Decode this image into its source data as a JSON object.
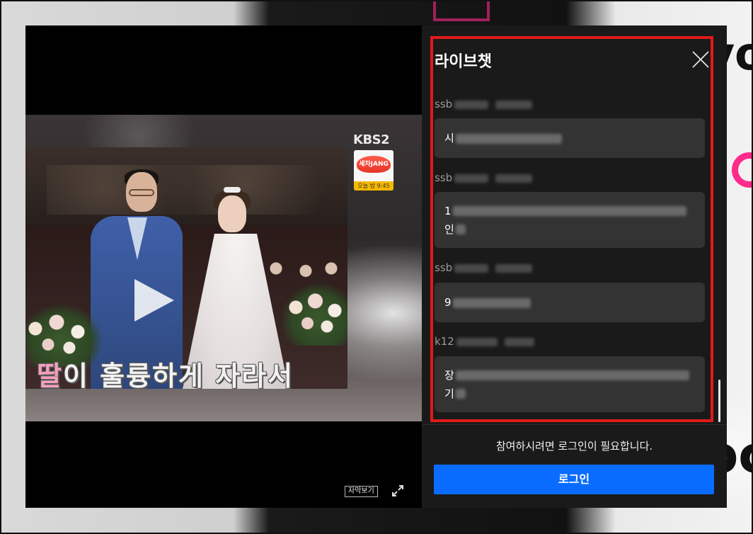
{
  "chat": {
    "title": "라이브챗",
    "messages": [
      {
        "user_prefix": "ssb",
        "lines": [
          {
            "prefix": "시",
            "blur_widths": [
              150
            ]
          }
        ]
      },
      {
        "user_prefix": "ssb",
        "lines": [
          {
            "prefix": "1",
            "blur_widths": [
              330
            ]
          },
          {
            "prefix": "인",
            "blur_widths": [
              14
            ]
          }
        ]
      },
      {
        "user_prefix": "ssb",
        "lines": [
          {
            "prefix": "9",
            "blur_widths": [
              110
            ]
          }
        ]
      },
      {
        "user_prefix": "k12",
        "lines": [
          {
            "prefix": "장",
            "blur_widths": [
              330
            ]
          },
          {
            "prefix": "기",
            "blur_widths": [
              14
            ]
          }
        ]
      }
    ],
    "login_required_text": "참여하시려면 로그인이 필요합니다.",
    "login_button_label": "로그인"
  },
  "player": {
    "caption_highlight": "딸",
    "caption_rest": "이 훌륭하게 자라서",
    "channel_logo": "KBS",
    "channel_number": "2",
    "show_logo_text": "세차JANG",
    "show_time": "오늘 밤 9:45",
    "subtitle_button_label": "자막보기"
  },
  "colors": {
    "accent": "#0a6cff",
    "highlight": "#e01a1a",
    "panel_bg": "#1a1a1a",
    "bubble_bg": "#333333"
  }
}
